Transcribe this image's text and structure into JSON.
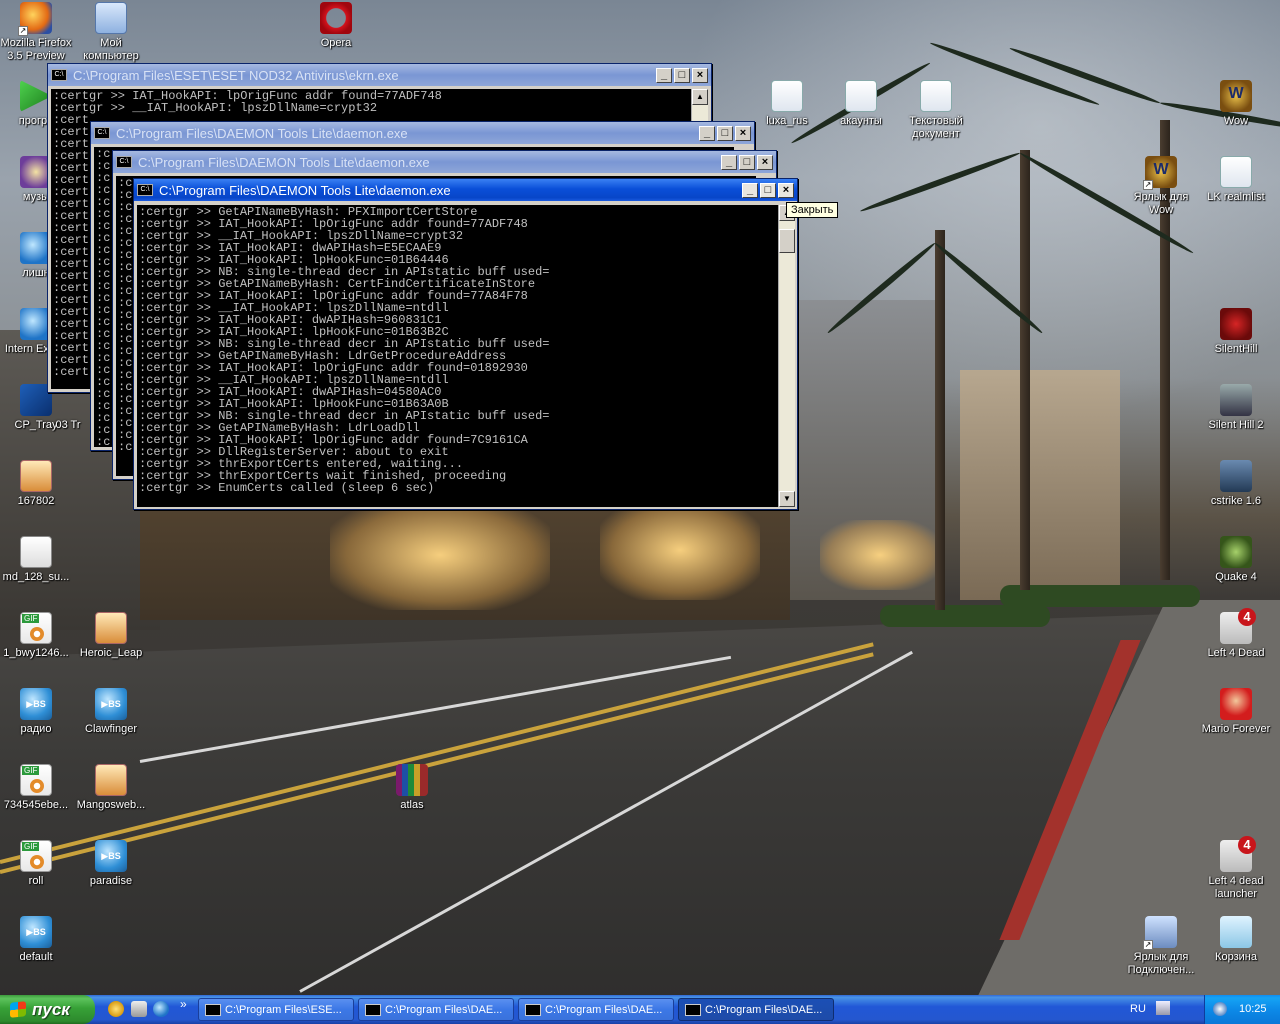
{
  "desktop_icons_left": [
    {
      "label": "Mozilla Firefox 3.5 Preview",
      "icon": "firefox-icon"
    },
    {
      "label": "Мой компьютер",
      "icon": "my-computer-icon"
    },
    {
      "label": "програ",
      "icon": "program-icon"
    },
    {
      "label": "музы",
      "icon": "music-icon"
    },
    {
      "label": "лишн",
      "icon": "folder-icon"
    },
    {
      "label": "Intern Explor",
      "icon": "internet-explorer-icon"
    },
    {
      "label": "CP_Tray",
      "icon": "cp-tray-icon"
    },
    {
      "label": "03 Tr",
      "icon": "file-icon"
    },
    {
      "label": "167802",
      "icon": "image-icon"
    },
    {
      "label": "md_128_su...",
      "icon": "mp3-icon"
    },
    {
      "label": "1_bwy1246...",
      "icon": "gif-icon"
    },
    {
      "label": "Heroic_Leap",
      "icon": "image-icon"
    },
    {
      "label": "радио",
      "icon": "bsplayer-icon"
    },
    {
      "label": "Clawfinger",
      "icon": "bsplayer-icon"
    },
    {
      "label": "734545ebe...",
      "icon": "gif-icon"
    },
    {
      "label": "Mangosweb...",
      "icon": "image-icon"
    },
    {
      "label": "roll",
      "icon": "gif-icon"
    },
    {
      "label": "paradise",
      "icon": "bsplayer-icon"
    },
    {
      "label": "default",
      "icon": "bsplayer-icon"
    },
    {
      "label": "atlas",
      "icon": "winrar-icon"
    }
  ],
  "desktop_icons_top": [
    {
      "label": "Opera",
      "icon": "opera-icon"
    },
    {
      "label": "luxa_rus",
      "icon": "document-icon"
    },
    {
      "label": "акаунты",
      "icon": "document-icon"
    },
    {
      "label": "Текстовый документ",
      "icon": "document-icon"
    }
  ],
  "desktop_icons_right": [
    {
      "label": "Wow",
      "icon": "wow-icon"
    },
    {
      "label": "Ярлык для Wow",
      "icon": "wow-icon"
    },
    {
      "label": "LK realmlist",
      "icon": "document-icon"
    },
    {
      "label": "SilentHill",
      "icon": "silent-hill-icon"
    },
    {
      "label": "Silent Hill 2",
      "icon": "silent-hill-2-icon"
    },
    {
      "label": "cstrike 1.6",
      "icon": "counter-strike-icon"
    },
    {
      "label": "Quake 4",
      "icon": "quake-icon"
    },
    {
      "label": "Left 4 Dead",
      "icon": "left4dead-icon"
    },
    {
      "label": "Mario Forever",
      "icon": "mario-icon"
    },
    {
      "label": "Left 4 dead launcher",
      "icon": "left4dead-launcher-icon"
    },
    {
      "label": "Ярлык для Подключен...",
      "icon": "network-connection-icon"
    },
    {
      "label": "Корзина",
      "icon": "recycle-bin-icon"
    }
  ],
  "windows": {
    "ekrn": {
      "title": "C:\\Program Files\\ESET\\ESET NOD32 Antivirus\\ekrn.exe",
      "lines": [
        ":certgr >> IAT_HookAPI: lpOrigFunc addr found=77ADF748",
        ":certgr >> __IAT_HookAPI: lpszDllName=crypt32",
        ":cert",
        ":cert",
        ":cert",
        ":cert",
        ":cert",
        ":cert",
        ":cert",
        ":cert",
        ":cert",
        ":cert",
        ":cert",
        ":cert",
        ":cert",
        ":cert",
        ":cert",
        ":cert",
        ":cert",
        ":cert",
        ":cert",
        ":cert",
        ":cert",
        ":cert"
      ]
    },
    "daemon1": {
      "title": "C:\\Program Files\\DAEMON Tools Lite\\daemon.exe",
      "lines": [
        ":c",
        ":c",
        ":c",
        ":c",
        ":c",
        ":c",
        ":c",
        ":c",
        ":c",
        ":c",
        ":c",
        ":c",
        ":c",
        ":c",
        ":c",
        ":c",
        ":c",
        ":c",
        ":c",
        ":c",
        ":c",
        ":c",
        ":c",
        ":c",
        ":c"
      ]
    },
    "daemon2": {
      "title": "C:\\Program Files\\DAEMON Tools Lite\\daemon.exe",
      "lines": [
        ":c",
        ":c",
        ":c",
        ":c",
        ":c",
        ":c",
        ":c",
        ":c",
        ":c",
        ":c",
        ":c",
        ":c",
        ":c",
        ":c",
        ":c",
        ":c",
        ":c",
        ":c",
        ":c",
        ":c",
        ":c",
        ":c",
        ":c"
      ]
    },
    "daemon3": {
      "title": "C:\\Program Files\\DAEMON Tools Lite\\daemon.exe",
      "lines": [
        ":certgr >> GetAPINameByHash: PFXImportCertStore",
        ":certgr >> IAT_HookAPI: lpOrigFunc addr found=77ADF748",
        ":certgr >> __IAT_HookAPI: lpszDllName=crypt32",
        ":certgr >> IAT_HookAPI: dwAPIHash=E5ECAAE9",
        ":certgr >> IAT_HookAPI: lpHookFunc=01B64446",
        ":certgr >> NB: single-thread decr in APIstatic buff used=",
        ":certgr >> GetAPINameByHash: CertFindCertificateInStore",
        ":certgr >> IAT_HookAPI: lpOrigFunc addr found=77A84F78",
        ":certgr >> __IAT_HookAPI: lpszDllName=ntdll",
        ":certgr >> IAT_HookAPI: dwAPIHash=960831C1",
        ":certgr >> IAT_HookAPI: lpHookFunc=01B63B2C",
        ":certgr >> NB: single-thread decr in APIstatic buff used=",
        ":certgr >> GetAPINameByHash: LdrGetProcedureAddress",
        ":certgr >> IAT_HookAPI: lpOrigFunc addr found=01892930",
        ":certgr >> __IAT_HookAPI: lpszDllName=ntdll",
        ":certgr >> IAT_HookAPI: dwAPIHash=04580AC0",
        ":certgr >> IAT_HookAPI: lpHookFunc=01B63A0B",
        ":certgr >> NB: single-thread decr in APIstatic buff used=",
        ":certgr >> GetAPINameByHash: LdrLoadDll",
        ":certgr >> IAT_HookAPI: lpOrigFunc addr found=7C9161CA",
        ":certgr >> DllRegisterServer: about to exit",
        ":certgr >> thrExportCerts entered, waiting...",
        ":certgr >> thrExportCerts wait finished, proceeding",
        ":certgr >> EnumCerts called (sleep 6 sec)"
      ]
    }
  },
  "window_buttons": {
    "minimize": "_",
    "maximize": "□",
    "close": "×"
  },
  "console_icon_text": "C:\\",
  "tooltip": "Закрыть",
  "taskbar": {
    "start_label": "пуск",
    "tasks": [
      {
        "label": "C:\\Program Files\\ESE...",
        "active": false
      },
      {
        "label": "C:\\Program Files\\DAE...",
        "active": false
      },
      {
        "label": "C:\\Program Files\\DAE...",
        "active": false
      },
      {
        "label": "C:\\Program Files\\DAE...",
        "active": true
      }
    ],
    "quick_launch_chevron": "»",
    "language": "RU",
    "clock": "10:25"
  }
}
